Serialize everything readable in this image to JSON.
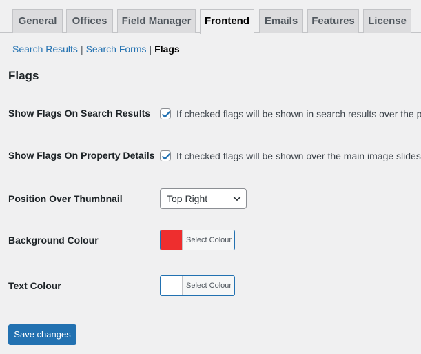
{
  "tabs": [
    {
      "label": "General",
      "active": false
    },
    {
      "label": "Offices",
      "active": false
    },
    {
      "label": "Field Manager",
      "active": false
    },
    {
      "label": "Frontend",
      "active": true
    },
    {
      "label": "Emails",
      "active": false
    },
    {
      "label": "Features",
      "active": false
    },
    {
      "label": "License",
      "active": false
    }
  ],
  "subnav": {
    "items": [
      "Search Results",
      "Search Forms"
    ],
    "separator": "|",
    "current": "Flags"
  },
  "section_title": "Flags",
  "fields": {
    "show_flags_search": {
      "label": "Show Flags On Search Results",
      "checked": true,
      "description": "If checked flags will be shown in search results over the pr"
    },
    "show_flags_property": {
      "label": "Show Flags On Property Details",
      "checked": true,
      "description": "If checked flags will be shown over the main image slidesh"
    },
    "position": {
      "label": "Position Over Thumbnail",
      "selected": "Top Right"
    },
    "background_colour": {
      "label": "Background Colour",
      "button_label": "Select Colour",
      "colour": "#ee2e2e"
    },
    "text_colour": {
      "label": "Text Colour",
      "button_label": "Select Colour",
      "colour": "#ffffff"
    }
  },
  "save_label": "Save changes",
  "colors": {
    "accent": "#2271b1",
    "background": "#f0f0f1"
  }
}
